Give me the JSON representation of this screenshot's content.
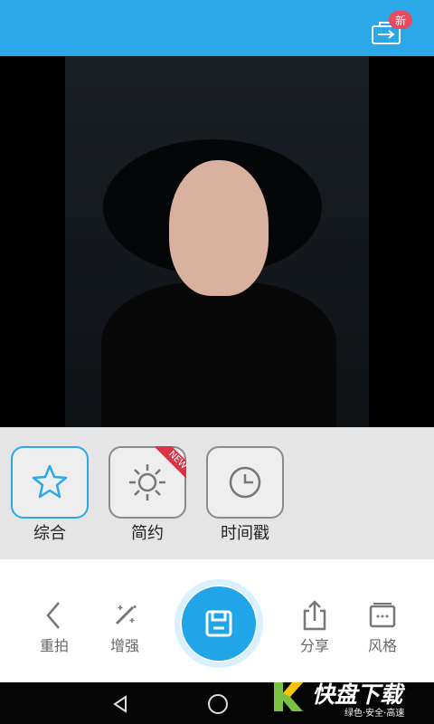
{
  "header": {
    "badge": "新"
  },
  "styles": {
    "cards": [
      {
        "label": "综合",
        "icon": "star-icon",
        "active": true
      },
      {
        "label": "简约",
        "icon": "sun-icon",
        "badge": "NEW"
      },
      {
        "label": "时间戳",
        "icon": "clock-icon"
      }
    ]
  },
  "toolbar": {
    "items": [
      {
        "label": "重拍",
        "icon": "back-chevron-icon"
      },
      {
        "label": "增强",
        "icon": "magic-wand-icon"
      },
      {
        "label": "分享",
        "icon": "share-icon"
      },
      {
        "label": "风格",
        "icon": "style-box-icon"
      }
    ],
    "save_icon": "save-icon"
  },
  "watermark": {
    "title": "快盘下载",
    "subtitle": "绿色·安全·高速"
  },
  "colors": {
    "accent": "#2aa8e8",
    "badge": "#e84a5f",
    "new_tag": "#d83445"
  }
}
